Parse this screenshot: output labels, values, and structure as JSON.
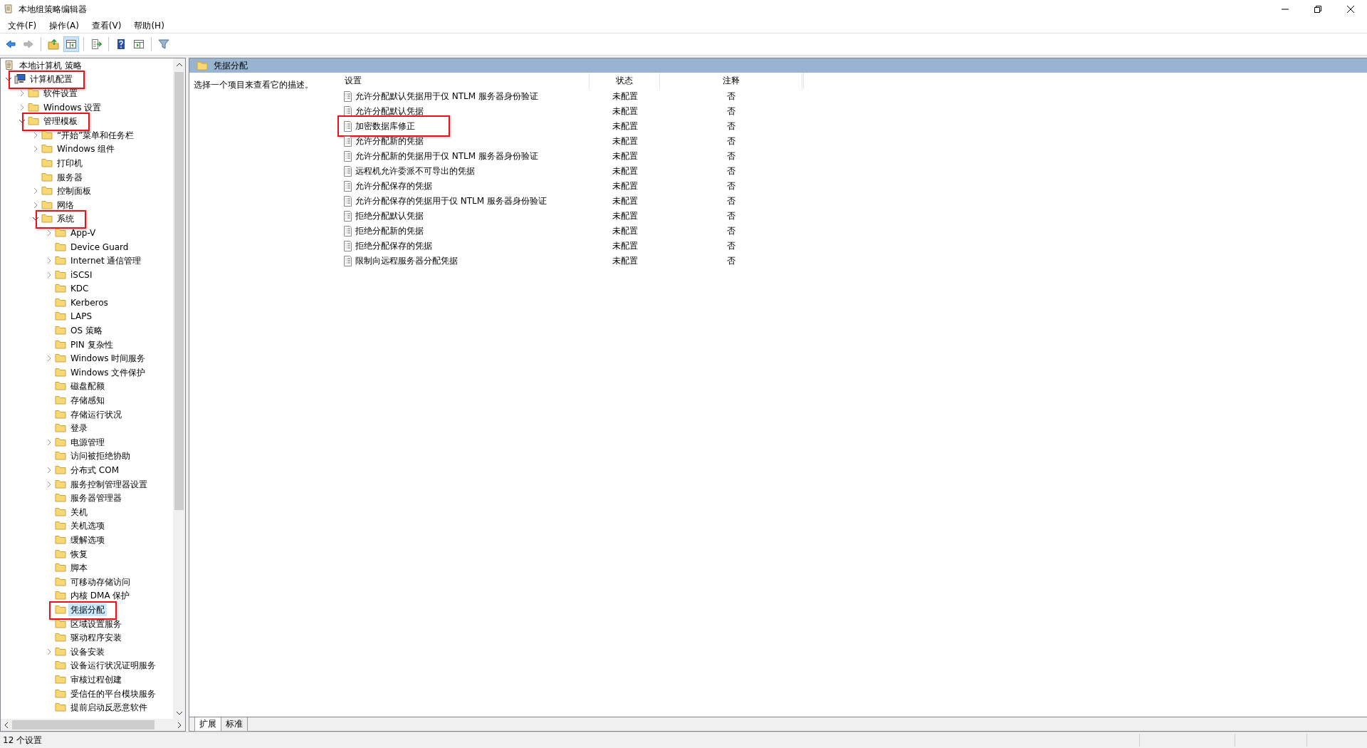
{
  "window": {
    "title": "本地组策略编辑器"
  },
  "menu": [
    "文件(F)",
    "操作(A)",
    "查看(V)",
    "帮助(H)"
  ],
  "toolbar": [
    {
      "disabled": false,
      "pressed": false
    },
    {
      "disabled": true,
      "pressed": false
    },
    {
      "disabled": false,
      "pressed": false
    },
    {
      "disabled": false,
      "pressed": true
    },
    {
      "disabled": false,
      "pressed": false
    },
    {
      "disabled": false,
      "pressed": false
    },
    {
      "disabled": false,
      "pressed": false
    },
    {
      "disabled": false,
      "pressed": false
    }
  ],
  "tree": [
    {
      "kind": "root",
      "label": "本地计算机 策略",
      "selected": false,
      "highlighted": false,
      "children": [
        {
          "kind": "computer",
          "label": "计算机配置",
          "expanded": true,
          "selected": false,
          "highlighted": true,
          "children": [
            {
              "kind": "folder",
              "label": "软件设置",
              "expanded": false,
              "selected": false,
              "highlighted": false
            },
            {
              "kind": "folder",
              "label": "Windows 设置",
              "expanded": false,
              "selected": false,
              "highlighted": false
            },
            {
              "kind": "folder",
              "label": "管理模板",
              "expanded": true,
              "selected": false,
              "highlighted": true,
              "children": [
                {
                  "kind": "folder",
                  "label": "“开始”菜单和任务栏",
                  "expanded": false,
                  "selected": false,
                  "highlighted": false
                },
                {
                  "kind": "folder",
                  "label": "Windows 组件",
                  "expanded": false,
                  "selected": false,
                  "highlighted": false
                },
                {
                  "kind": "folder",
                  "label": "打印机",
                  "selected": false,
                  "highlighted": false
                },
                {
                  "kind": "folder",
                  "label": "服务器",
                  "selected": false,
                  "highlighted": false
                },
                {
                  "kind": "folder",
                  "label": "控制面板",
                  "expanded": false,
                  "selected": false,
                  "highlighted": false
                },
                {
                  "kind": "folder",
                  "label": "网络",
                  "expanded": false,
                  "selected": false,
                  "highlighted": false
                },
                {
                  "kind": "folder",
                  "label": "系统",
                  "expanded": true,
                  "selected": false,
                  "highlighted": true,
                  "children": [
                    {
                      "kind": "folder",
                      "label": "App-V",
                      "expanded": false,
                      "selected": false,
                      "highlighted": false
                    },
                    {
                      "kind": "folder",
                      "label": "Device Guard",
                      "selected": false,
                      "highlighted": false
                    },
                    {
                      "kind": "folder",
                      "label": "Internet 通信管理",
                      "expanded": false,
                      "selected": false,
                      "highlighted": false
                    },
                    {
                      "kind": "folder",
                      "label": "iSCSI",
                      "expanded": false,
                      "selected": false,
                      "highlighted": false
                    },
                    {
                      "kind": "folder",
                      "label": "KDC",
                      "selected": false,
                      "highlighted": false
                    },
                    {
                      "kind": "folder",
                      "label": "Kerberos",
                      "selected": false,
                      "highlighted": false
                    },
                    {
                      "kind": "folder",
                      "label": "LAPS",
                      "selected": false,
                      "highlighted": false
                    },
                    {
                      "kind": "folder",
                      "label": "OS 策略",
                      "selected": false,
                      "highlighted": false
                    },
                    {
                      "kind": "folder",
                      "label": "PIN 复杂性",
                      "selected": false,
                      "highlighted": false
                    },
                    {
                      "kind": "folder",
                      "label": "Windows 时间服务",
                      "expanded": false,
                      "selected": false,
                      "highlighted": false
                    },
                    {
                      "kind": "folder",
                      "label": "Windows 文件保护",
                      "selected": false,
                      "highlighted": false
                    },
                    {
                      "kind": "folder",
                      "label": "磁盘配额",
                      "selected": false,
                      "highlighted": false
                    },
                    {
                      "kind": "folder",
                      "label": "存储感知",
                      "selected": false,
                      "highlighted": false
                    },
                    {
                      "kind": "folder",
                      "label": "存储运行状况",
                      "selected": false,
                      "highlighted": false
                    },
                    {
                      "kind": "folder",
                      "label": "登录",
                      "selected": false,
                      "highlighted": false
                    },
                    {
                      "kind": "folder",
                      "label": "电源管理",
                      "expanded": false,
                      "selected": false,
                      "highlighted": false
                    },
                    {
                      "kind": "folder",
                      "label": "访问被拒绝协助",
                      "selected": false,
                      "highlighted": false
                    },
                    {
                      "kind": "folder",
                      "label": "分布式 COM",
                      "expanded": false,
                      "selected": false,
                      "highlighted": false
                    },
                    {
                      "kind": "folder",
                      "label": "服务控制管理器设置",
                      "expanded": false,
                      "selected": false,
                      "highlighted": false
                    },
                    {
                      "kind": "folder",
                      "label": "服务器管理器",
                      "selected": false,
                      "highlighted": false
                    },
                    {
                      "kind": "folder",
                      "label": "关机",
                      "selected": false,
                      "highlighted": false
                    },
                    {
                      "kind": "folder",
                      "label": "关机选项",
                      "selected": false,
                      "highlighted": false
                    },
                    {
                      "kind": "folder",
                      "label": "缓解选项",
                      "selected": false,
                      "highlighted": false
                    },
                    {
                      "kind": "folder",
                      "label": "恢复",
                      "selected": false,
                      "highlighted": false
                    },
                    {
                      "kind": "folder",
                      "label": "脚本",
                      "selected": false,
                      "highlighted": false
                    },
                    {
                      "kind": "folder",
                      "label": "可移动存储访问",
                      "selected": false,
                      "highlighted": false
                    },
                    {
                      "kind": "folder",
                      "label": "内核 DMA 保护",
                      "selected": false,
                      "highlighted": false
                    },
                    {
                      "kind": "folder",
                      "label": "凭据分配",
                      "selected": true,
                      "highlighted": true
                    },
                    {
                      "kind": "folder",
                      "label": "区域设置服务",
                      "selected": false,
                      "highlighted": false
                    },
                    {
                      "kind": "folder",
                      "label": "驱动程序安装",
                      "selected": false,
                      "highlighted": false
                    },
                    {
                      "kind": "folder",
                      "label": "设备安装",
                      "expanded": false,
                      "selected": false,
                      "highlighted": false
                    },
                    {
                      "kind": "folder",
                      "label": "设备运行状况证明服务",
                      "selected": false,
                      "highlighted": false
                    },
                    {
                      "kind": "folder",
                      "label": "审核过程创建",
                      "selected": false,
                      "highlighted": false
                    },
                    {
                      "kind": "folder",
                      "label": "受信任的平台模块服务",
                      "selected": false,
                      "highlighted": false
                    },
                    {
                      "kind": "folder",
                      "label": "提前启动反恶意软件",
                      "selected": false,
                      "highlighted": false
                    }
                  ]
                }
              ]
            }
          ]
        }
      ]
    }
  ],
  "pane": {
    "title": "凭据分配",
    "description": "选择一个项目来查看它的描述。"
  },
  "table": {
    "columns": [
      "设置",
      "状态",
      "注释"
    ],
    "rows": [
      {
        "setting": "允许分配默认凭据用于仅 NTLM 服务器身份验证",
        "state": "未配置",
        "comment": "否",
        "highlighted": false
      },
      {
        "setting": "允许分配默认凭据",
        "state": "未配置",
        "comment": "否",
        "highlighted": false
      },
      {
        "setting": "加密数据库修正",
        "state": "未配置",
        "comment": "否",
        "highlighted": true
      },
      {
        "setting": "允许分配新的凭据",
        "state": "未配置",
        "comment": "否",
        "highlighted": false
      },
      {
        "setting": "允许分配新的凭据用于仅 NTLM 服务器身份验证",
        "state": "未配置",
        "comment": "否",
        "highlighted": false
      },
      {
        "setting": "远程机允许委派不可导出的凭据",
        "state": "未配置",
        "comment": "否",
        "highlighted": false
      },
      {
        "setting": "允许分配保存的凭据",
        "state": "未配置",
        "comment": "否",
        "highlighted": false
      },
      {
        "setting": "允许分配保存的凭据用于仅 NTLM 服务器身份验证",
        "state": "未配置",
        "comment": "否",
        "highlighted": false
      },
      {
        "setting": "拒绝分配默认凭据",
        "state": "未配置",
        "comment": "否",
        "highlighted": false
      },
      {
        "setting": "拒绝分配新的凭据",
        "state": "未配置",
        "comment": "否",
        "highlighted": false
      },
      {
        "setting": "拒绝分配保存的凭据",
        "state": "未配置",
        "comment": "否",
        "highlighted": false
      },
      {
        "setting": "限制向远程服务器分配凭据",
        "state": "未配置",
        "comment": "否",
        "highlighted": false
      }
    ]
  },
  "view_tabs": [
    {
      "label": "扩展",
      "selected": true
    },
    {
      "label": "标准",
      "selected": false
    }
  ],
  "status_bar": "12 个设置"
}
